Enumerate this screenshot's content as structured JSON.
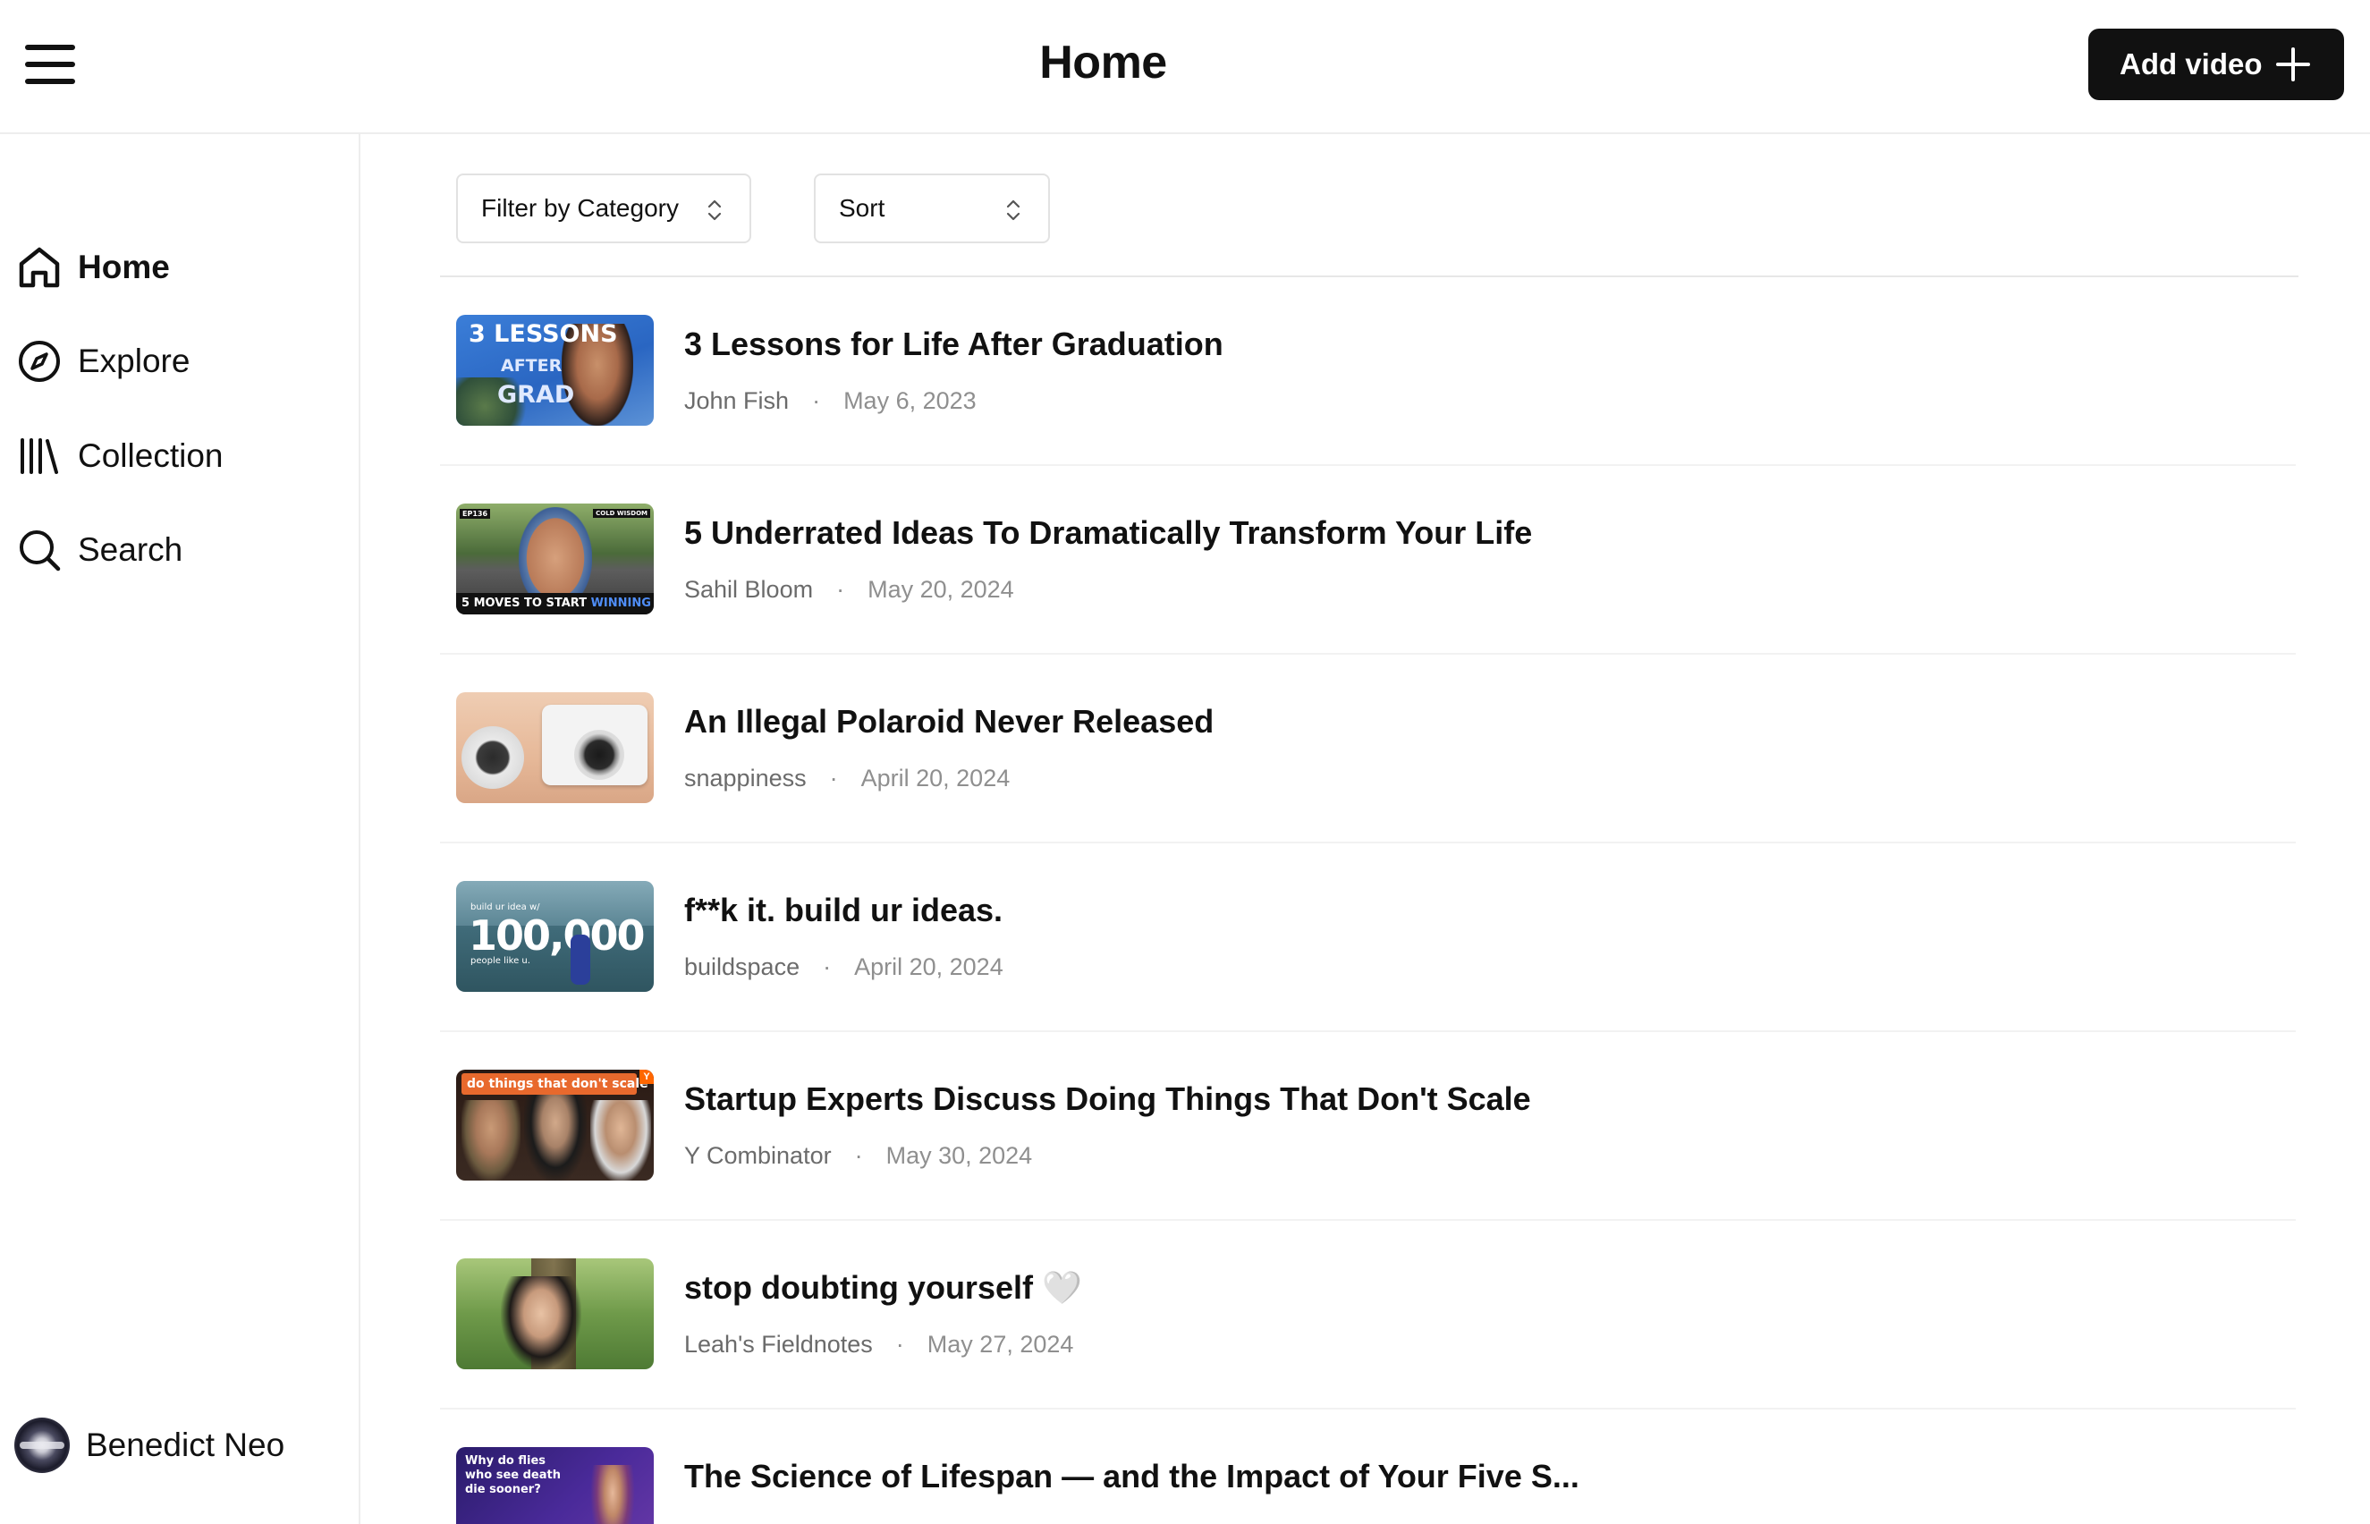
{
  "header": {
    "title": "Home",
    "add_video_label": "Add video"
  },
  "sidebar": {
    "items": [
      {
        "label": "Home",
        "icon": "home-icon",
        "active": true
      },
      {
        "label": "Explore",
        "icon": "compass-icon"
      },
      {
        "label": "Collection",
        "icon": "library-icon"
      },
      {
        "label": "Search",
        "icon": "search-icon"
      }
    ],
    "user": {
      "name": "Benedict Neo"
    }
  },
  "filters": {
    "category_label": "Filter by Category",
    "sort_label": "Sort"
  },
  "videos": [
    {
      "title": "3 Lessons for Life After Graduation",
      "author": "John Fish",
      "date": "May 6, 2023",
      "thumb_text": "3 LESSONS AFTER GRAD"
    },
    {
      "title": "5 Underrated Ideas To Dramatically Transform Your Life",
      "author": "Sahil Bloom",
      "date": "May 20, 2024",
      "thumb_text": "5 MOVES TO START WINNING"
    },
    {
      "title": "An Illegal Polaroid Never Released",
      "author": "snappiness",
      "date": "April 20, 2024",
      "thumb_text": ""
    },
    {
      "title": "f**k it. build ur ideas.",
      "author": "buildspace",
      "date": "April 20, 2024",
      "thumb_text": "100,000"
    },
    {
      "title": "Startup Experts Discuss Doing Things That Don't Scale",
      "author": "Y Combinator",
      "date": "May 30, 2024",
      "thumb_text": "do things that don't scale"
    },
    {
      "title": "stop doubting yourself 🤍",
      "author": "Leah's Fieldnotes",
      "date": "May 27, 2024",
      "thumb_text": ""
    },
    {
      "title": "The Science of Lifespan — and the Impact of Your Five S...",
      "author": "",
      "date": "",
      "thumb_text": "Why do flies who see death die sooner?"
    }
  ]
}
